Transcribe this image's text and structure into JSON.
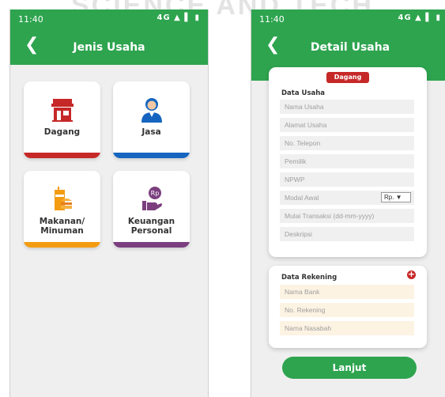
{
  "watermark": "SCIENCE AND TECH",
  "status_bar": {
    "time": "11:40",
    "signal_text": "4G ▲ ▌ ▮"
  },
  "screen1": {
    "title": "Jenis Usaha",
    "tiles": [
      {
        "label_1": "Dagang",
        "label_2": "",
        "icon": "store-icon",
        "color": "#c62828"
      },
      {
        "label_1": "Jasa",
        "label_2": "",
        "icon": "person-icon",
        "color": "#1565c0"
      },
      {
        "label_1": "Makanan/",
        "label_2": "Minuman",
        "icon": "food-drink-icon",
        "color": "#f39c12"
      },
      {
        "label_1": "Keuangan",
        "label_2": "Personal",
        "icon": "money-hand-icon",
        "color": "#7b3f7f"
      }
    ]
  },
  "screen2": {
    "title": "Detail Usaha",
    "badge": "Dagang",
    "data_usaha": {
      "heading": "Data Usaha",
      "fields": [
        "Nama Usaha",
        "Alamat Usaha",
        "No. Telepon",
        "Pemilik",
        "NPWP",
        "Modal Awal",
        "Mulai Transaksi (dd-mm-yyyy)",
        "Deskripsi"
      ],
      "currency": "Rp.   ▼"
    },
    "data_rekening": {
      "heading": "Data Rekening",
      "fields": [
        "Nama Bank",
        "No. Rekening",
        "Nama Nasabah"
      ]
    },
    "button": "Lanjut"
  },
  "colors": {
    "primary_green": "#2ea44f",
    "red": "#c62828",
    "blue": "#1565c0",
    "orange": "#f39c12",
    "purple": "#7b3f7f"
  }
}
